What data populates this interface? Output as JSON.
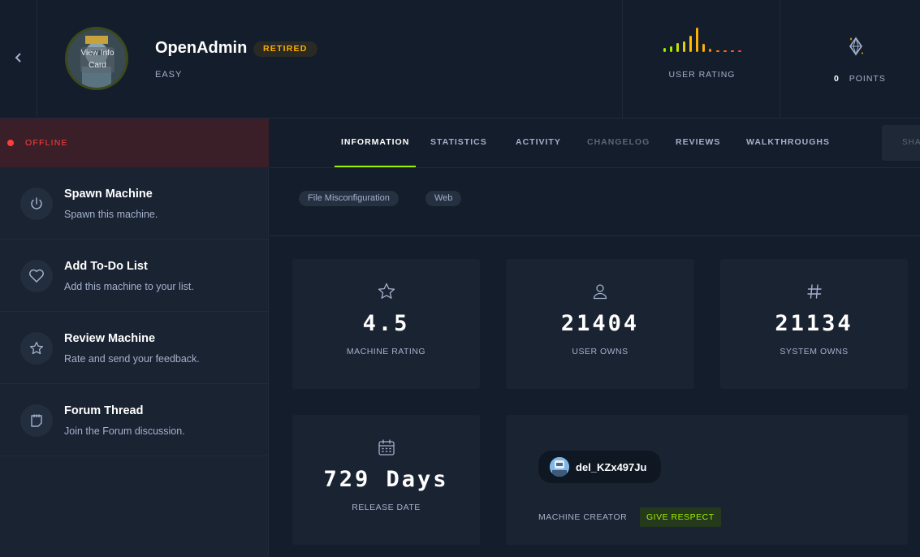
{
  "header": {
    "back_icon": "chevron-left-icon",
    "avatar_overlay": "View Info Card",
    "machine_name": "OpenAdmin",
    "status_badge": "RETIRED",
    "difficulty": "EASY",
    "rating_label": "USER RATING",
    "points_value": "0",
    "points_label": "POINTS",
    "accent_orange": "#ffaf00",
    "accent_green": "#9fef00"
  },
  "sidebar": {
    "status": "OFFLINE",
    "status_color": "#ff3e3e",
    "actions": [
      {
        "title": "Spawn Machine",
        "subtitle": "Spawn this machine.",
        "icon": "power-icon"
      },
      {
        "title": "Add To-Do List",
        "subtitle": "Add this machine to your list.",
        "icon": "heart-icon"
      },
      {
        "title": "Review Machine",
        "subtitle": "Rate and send your feedback.",
        "icon": "star-icon"
      },
      {
        "title": "Forum Thread",
        "subtitle": "Join the Forum discussion.",
        "icon": "forum-icon"
      }
    ]
  },
  "tabs": [
    {
      "label": "INFORMATION",
      "state": "active"
    },
    {
      "label": "STATISTICS",
      "state": "normal"
    },
    {
      "label": "ACTIVITY",
      "state": "normal"
    },
    {
      "label": "CHANGELOG",
      "state": "disabled"
    },
    {
      "label": "REVIEWS",
      "state": "normal"
    },
    {
      "label": "WALKTHROUGHS",
      "state": "normal"
    }
  ],
  "share_label": "SHA",
  "tags": [
    "File Misconfiguration",
    "Web"
  ],
  "stats": [
    {
      "value": "4.5",
      "label": "MACHINE RATING",
      "icon": "star-icon"
    },
    {
      "value": "21404",
      "label": "USER OWNS",
      "icon": "user-icon"
    },
    {
      "value": "21134",
      "label": "SYSTEM OWNS",
      "icon": "hash-icon"
    }
  ],
  "release": {
    "value": "729 Days",
    "label": "RELEASE DATE",
    "icon": "calendar-icon"
  },
  "creator": {
    "name": "del_KZx497Ju",
    "label": "MACHINE CREATOR",
    "respect_button": "GIVE RESPECT"
  }
}
